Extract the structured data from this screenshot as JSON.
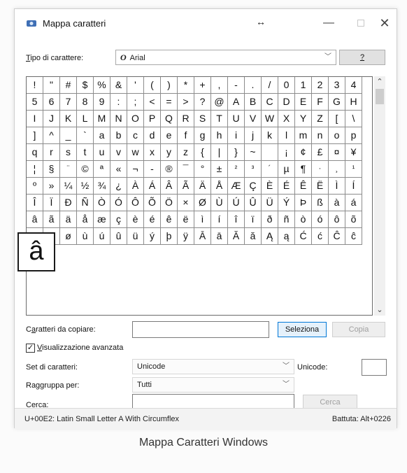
{
  "window": {
    "title": "Mappa caratteri",
    "resize_glyph": "↔"
  },
  "titlebar_buttons": {
    "minimize": "—",
    "close": "✕"
  },
  "font_row": {
    "label": "Tipo di carattere:",
    "label_underline": "T",
    "value": "Arial",
    "help_label": "?",
    "font_icon": "O"
  },
  "grid": {
    "rows": [
      [
        "!",
        "\"",
        "#",
        "$",
        "%",
        "&",
        "'",
        "(",
        ")",
        "*",
        "+",
        ",",
        "-",
        ".",
        "/",
        "0",
        "1",
        "2",
        "3",
        "4"
      ],
      [
        "5",
        "6",
        "7",
        "8",
        "9",
        ":",
        ";",
        "<",
        "=",
        ">",
        "?",
        "@",
        "A",
        "B",
        "C",
        "D",
        "E",
        "F",
        "G",
        "H"
      ],
      [
        "I",
        "J",
        "K",
        "L",
        "M",
        "N",
        "O",
        "P",
        "Q",
        "R",
        "S",
        "T",
        "U",
        "V",
        "W",
        "X",
        "Y",
        "Z",
        "[",
        "\\"
      ],
      [
        "]",
        "^",
        "_",
        "`",
        "a",
        "b",
        "c",
        "d",
        "e",
        "f",
        "g",
        "h",
        "i",
        "j",
        "k",
        "l",
        "m",
        "n",
        "o",
        "p"
      ],
      [
        "q",
        "r",
        "s",
        "t",
        "u",
        "v",
        "w",
        "x",
        "y",
        "z",
        "{",
        "|",
        "}",
        "~",
        " ",
        "¡",
        "¢",
        "£",
        "¤",
        "¥"
      ],
      [
        "¦",
        "§",
        "¨",
        "©",
        "ª",
        "«",
        "¬",
        "-",
        "®",
        "¯",
        "°",
        "±",
        "²",
        "³",
        "´",
        "µ",
        "¶",
        "·",
        "¸",
        "¹"
      ],
      [
        "º",
        "»",
        "¼",
        "½",
        "¾",
        "¿",
        "À",
        "Á",
        "Â",
        "Ã",
        "Ä",
        "Å",
        "Æ",
        "Ç",
        "È",
        "É",
        "Ê",
        "Ë",
        "Ì",
        "Í"
      ],
      [
        "Î",
        "Ï",
        "Ð",
        "Ñ",
        "Ò",
        "Ó",
        "Ô",
        "Õ",
        "Ö",
        "×",
        "Ø",
        "Ù",
        "Ú",
        "Û",
        "Ü",
        "Ý",
        "Þ",
        "ß",
        "à",
        "á"
      ],
      [
        "â",
        "ã",
        "ä",
        "å",
        "æ",
        "ç",
        "è",
        "é",
        "ê",
        "ë",
        "ì",
        "í",
        "î",
        "ï",
        "ð",
        "ñ",
        "ò",
        "ó",
        "ô",
        "õ"
      ],
      [
        "ö",
        "÷",
        "ø",
        "ù",
        "ú",
        "û",
        "ü",
        "ý",
        "þ",
        "ÿ",
        "Ā",
        "ā",
        "Ă",
        "ă",
        "Ą",
        "ą",
        "Ć",
        "ć",
        "Ĉ",
        "ĉ"
      ]
    ],
    "zoomed_char": "â"
  },
  "copy_row": {
    "label": "Caratteri da copiare:",
    "label_underline": "a",
    "value": "",
    "select_button": "Seleziona",
    "copy_button": "Copia"
  },
  "advanced": {
    "label": "Visualizzazione avanzata",
    "label_underline": "V",
    "checked": true,
    "check_glyph": "✓"
  },
  "charset_row": {
    "label": "Set di caratteri:",
    "value": "Unicode",
    "unicode_label": "Unicode:",
    "unicode_value": ""
  },
  "group_row": {
    "label": "Raggruppa per:",
    "value": "Tutti"
  },
  "search_row": {
    "label": "Cerca:",
    "value": "",
    "button": "Cerca"
  },
  "status": {
    "left": "U+00E2: Latin Small Letter A With Circumflex",
    "right": "Battuta: Alt+0226"
  },
  "caption": "Mappa Caratteri Windows",
  "colors": {
    "accent": "#0078d7",
    "grid_border": "#6b6b6b",
    "icon_blue": "#3f6fb5"
  }
}
